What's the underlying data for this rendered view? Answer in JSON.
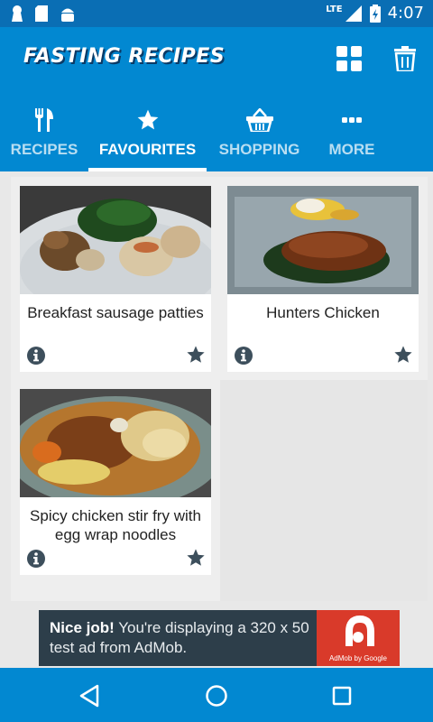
{
  "status_bar": {
    "network": "LTE",
    "time": "4:07"
  },
  "app": {
    "title": "Fasting Recipes"
  },
  "tabs": [
    {
      "label": "RECIPES",
      "icon": "fork-knife-icon",
      "active": false
    },
    {
      "label": "FAVOURITES",
      "icon": "star-icon",
      "active": true
    },
    {
      "label": "SHOPPING",
      "icon": "basket-icon",
      "active": false
    },
    {
      "label": "MORE",
      "icon": "more-dots-icon",
      "active": false
    }
  ],
  "recipes": [
    {
      "title": "Breakfast sausage patties",
      "favourite": true
    },
    {
      "title": "Hunters Chicken",
      "favourite": true
    },
    {
      "title": "Spicy chicken stir fry with egg wrap noodles",
      "favourite": true
    }
  ],
  "ad": {
    "headline": "Nice job!",
    "body": "You're displaying a 320 x 50 test ad from AdMob.",
    "logo_text": "AdMob by Google"
  },
  "colors": {
    "primary": "#0288d1",
    "status_bar": "#0a6eb4",
    "icon_dark": "#3d4f5c"
  }
}
